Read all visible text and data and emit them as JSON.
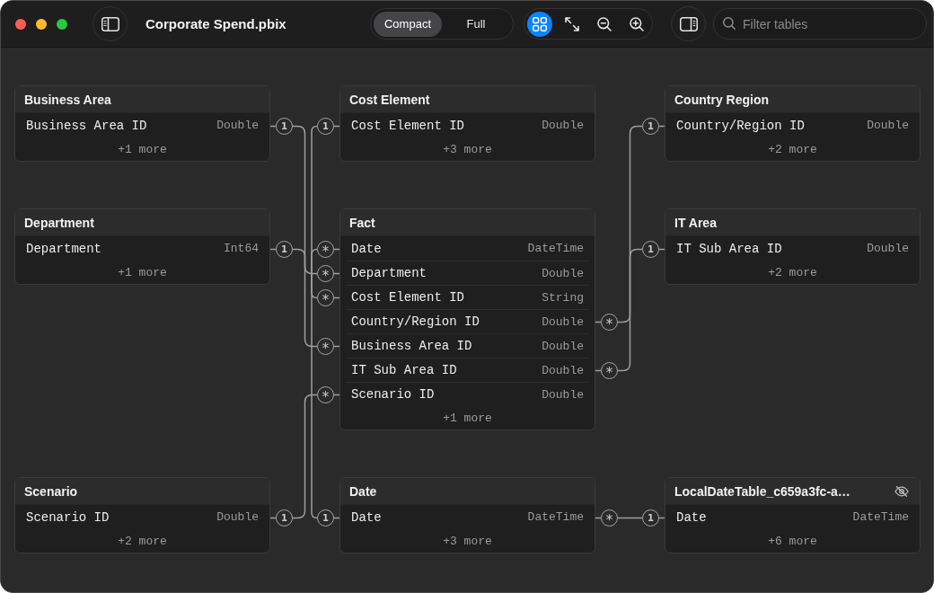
{
  "window": {
    "title": "Corporate Spend.pbix"
  },
  "view_modes": [
    {
      "label": "Compact",
      "selected": true
    },
    {
      "label": "Full",
      "selected": false
    }
  ],
  "canvas_tools": [
    {
      "kind": "arrange",
      "selected": true
    },
    {
      "kind": "fit",
      "selected": false
    },
    {
      "kind": "zoom_out",
      "selected": false
    },
    {
      "kind": "zoom_in",
      "selected": false
    }
  ],
  "search": {
    "placeholder": "Filter tables"
  },
  "tables": [
    {
      "title": "Business Area",
      "hidden": false,
      "columns": [
        {
          "name": "Business Area ID",
          "type": "Double",
          "markers": [
            {
              "kind": "one",
              "mark": "1"
            }
          ]
        }
      ],
      "more": "+1 more"
    },
    {
      "title": "Cost Element",
      "hidden": false,
      "columns": [
        {
          "name": "Cost Element ID",
          "type": "Double",
          "markers": [
            {
              "kind": "one",
              "mark": "1"
            }
          ]
        }
      ],
      "more": "+3 more"
    },
    {
      "title": "Country Region",
      "hidden": false,
      "columns": [
        {
          "name": "Country/Region ID",
          "type": "Double",
          "markers": [
            {
              "kind": "one",
              "mark": "1"
            }
          ]
        }
      ],
      "more": "+2 more"
    },
    {
      "title": "Department",
      "hidden": false,
      "columns": [
        {
          "name": "Department",
          "type": "Int64",
          "markers": [
            {
              "kind": "one",
              "mark": "1"
            }
          ]
        }
      ],
      "more": "+1 more"
    },
    {
      "title": "Fact",
      "hidden": false,
      "columns": [
        {
          "name": "Date",
          "type": "DateTime",
          "markers": [
            {
              "kind": "many",
              "mark": "*"
            }
          ]
        },
        {
          "name": "Department",
          "type": "Double",
          "markers": [
            {
              "kind": "many",
              "mark": "*"
            }
          ]
        },
        {
          "name": "Cost Element ID",
          "type": "String",
          "markers": [
            {
              "kind": "many",
              "mark": "*"
            }
          ]
        },
        {
          "name": "Country/Region ID",
          "type": "Double",
          "markers": [
            {
              "kind": "many",
              "mark": "*"
            }
          ]
        },
        {
          "name": "Business Area ID",
          "type": "Double",
          "markers": [
            {
              "kind": "many",
              "mark": "*"
            }
          ]
        },
        {
          "name": "IT Sub Area ID",
          "type": "Double",
          "markers": [
            {
              "kind": "many",
              "mark": "*"
            }
          ]
        },
        {
          "name": "Scenario ID",
          "type": "Double",
          "markers": [
            {
              "kind": "many",
              "mark": "*"
            }
          ]
        }
      ],
      "more": "+1 more"
    },
    {
      "title": "IT Area",
      "hidden": false,
      "columns": [
        {
          "name": "IT Sub Area ID",
          "type": "Double",
          "markers": [
            {
              "kind": "one",
              "mark": "1"
            }
          ]
        }
      ],
      "more": "+2 more"
    },
    {
      "title": "Scenario",
      "hidden": false,
      "columns": [
        {
          "name": "Scenario ID",
          "type": "Double",
          "markers": [
            {
              "kind": "one",
              "mark": "1"
            }
          ]
        }
      ],
      "more": "+2 more"
    },
    {
      "title": "Date",
      "hidden": false,
      "columns": [
        {
          "name": "Date",
          "type": "DateTime",
          "markers": [
            {
              "kind": "one",
              "mark": "1"
            },
            {
              "kind": "many",
              "mark": "*"
            }
          ]
        }
      ],
      "more": "+3 more"
    },
    {
      "title": "LocalDateTable_c659a3fc-a…",
      "hidden": true,
      "columns": [
        {
          "name": "Date",
          "type": "DateTime",
          "markers": [
            {
              "kind": "one",
              "mark": "1"
            }
          ]
        }
      ],
      "more": "+6 more"
    }
  ]
}
